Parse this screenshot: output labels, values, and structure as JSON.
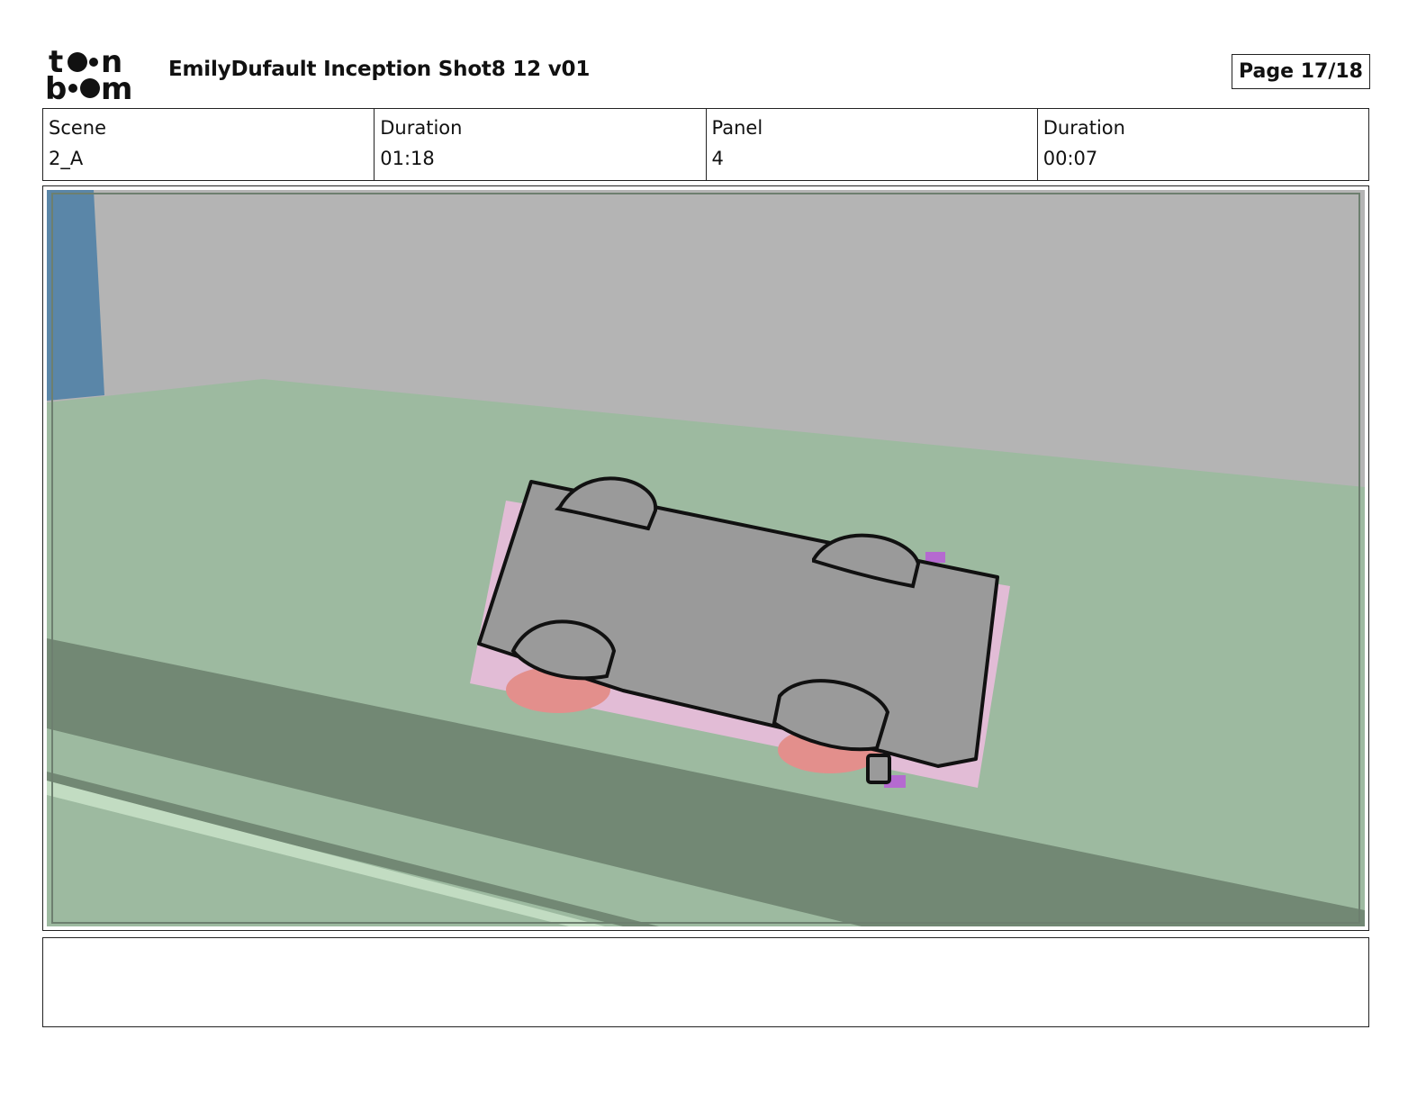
{
  "header": {
    "logo_text": "toon boom",
    "document_title": "EmilyDufault Inception Shot8 12 v01",
    "page_label": "Page 17/18"
  },
  "info": {
    "scene": {
      "label": "Scene",
      "value": "2_A"
    },
    "scene_duration": {
      "label": "Duration",
      "value": "01:18"
    },
    "panel": {
      "label": "Panel",
      "value": "4"
    },
    "panel_duration": {
      "label": "Duration",
      "value": "00:07"
    }
  },
  "panel_image": {
    "subject": "car-on-ground-plane-icon",
    "colors": {
      "wall": "#b4b4b4",
      "ground": "#9dbaa0",
      "road_shadow": "#728874",
      "blue_pillar": "#5a86a8",
      "car_body": "#9a9a9a",
      "car_shadow": "#e2bcd6",
      "wheel_under": "#e38f8c"
    }
  },
  "notes": {
    "text": ""
  }
}
